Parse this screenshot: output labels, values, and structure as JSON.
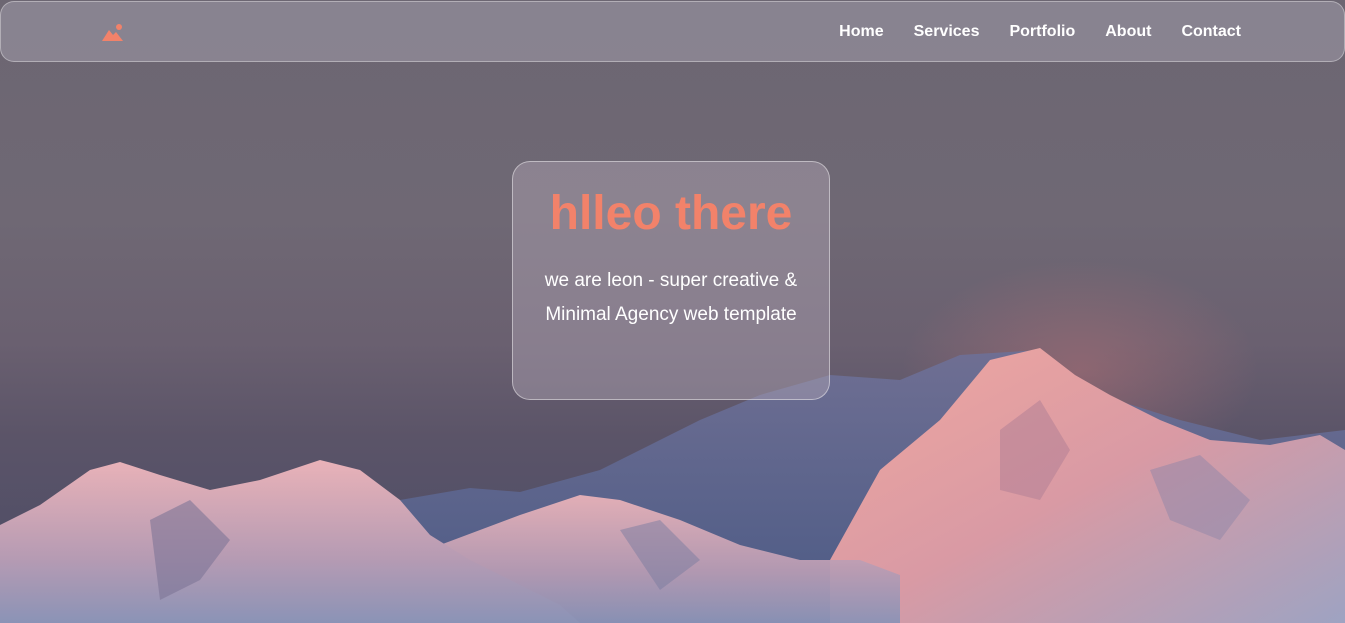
{
  "header": {
    "logo_icon": "mountain-sun-icon",
    "nav": [
      {
        "label": "Home"
      },
      {
        "label": "Services"
      },
      {
        "label": "Portfolio"
      },
      {
        "label": "About"
      },
      {
        "label": "Contact"
      }
    ]
  },
  "hero": {
    "title": "hlleo there",
    "subtitle": "we are leon - super creative & Minimal Agency web template"
  },
  "colors": {
    "accent": "#f2826a",
    "nav_text": "#ffffff"
  }
}
